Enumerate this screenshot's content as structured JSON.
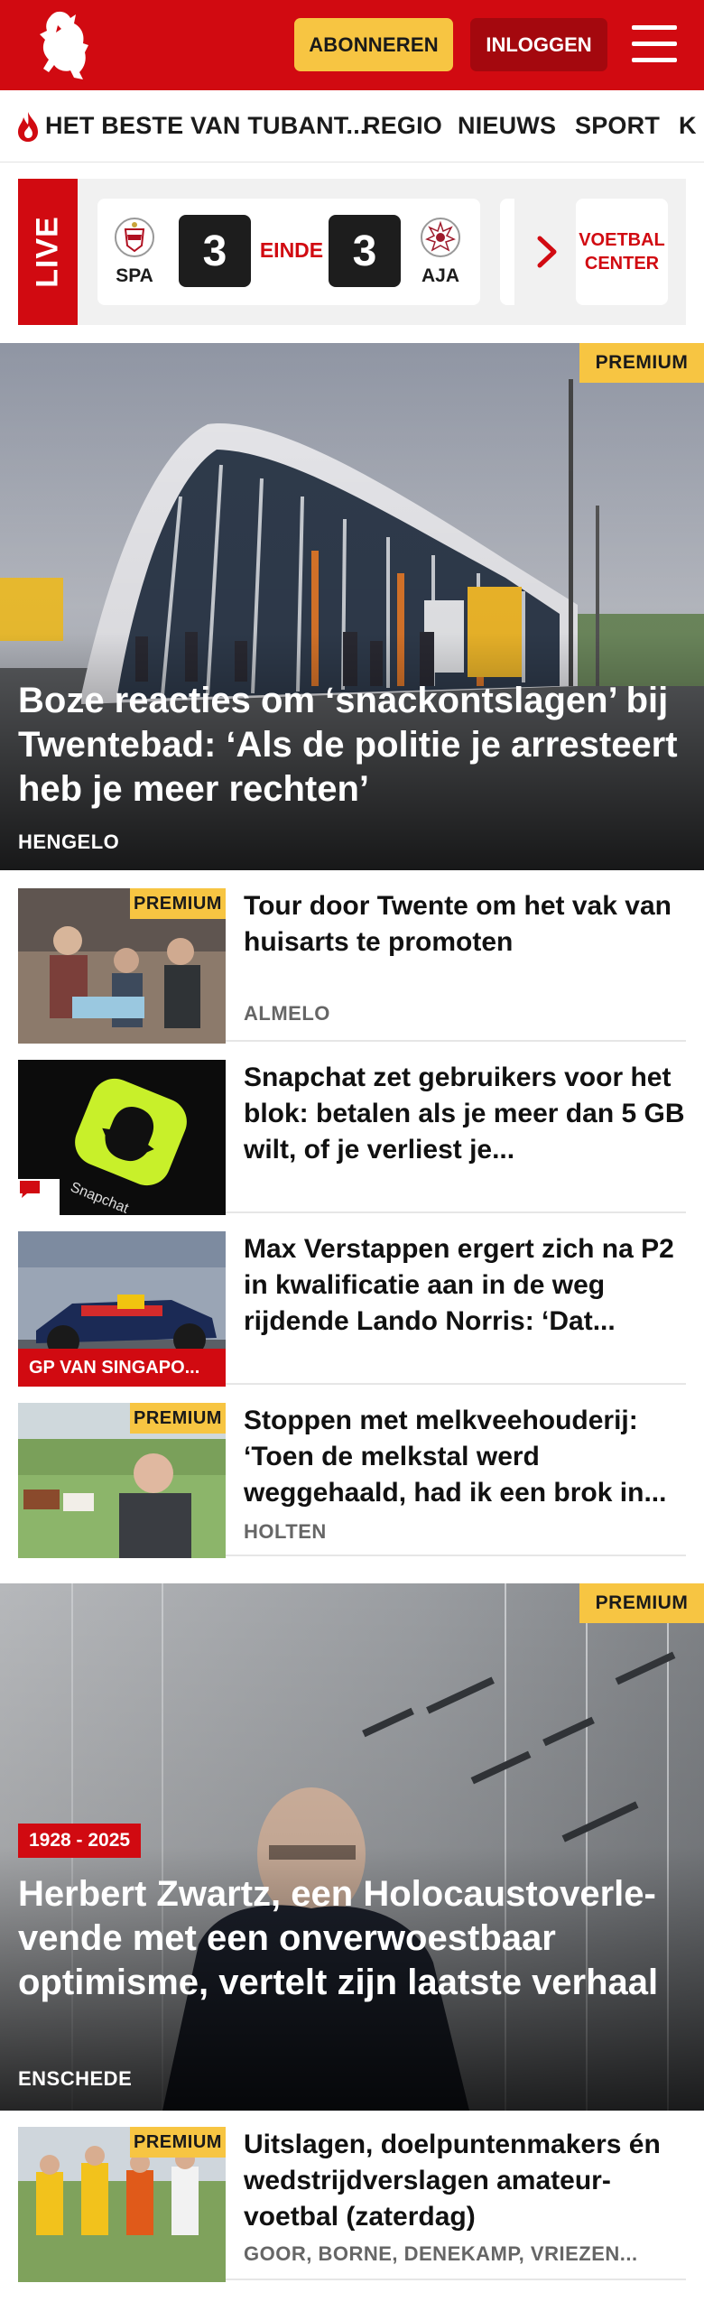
{
  "header": {
    "subscribe_label": "ABONNEREN",
    "login_label": "INLOGGEN",
    "brand_color": "#d10a11",
    "subscribe_color": "#f7c542",
    "icons": [
      "tubantia-horse-logo",
      "hamburger-menu-icon"
    ]
  },
  "nav": {
    "items": [
      "HET BESTE VAN TUBANT...",
      "REGIO",
      "NIEUWS",
      "SPORT",
      "K"
    ],
    "highlight_icon": "flame-icon"
  },
  "live": {
    "label": "LIVE",
    "match": {
      "home": "SPA",
      "away": "AJA",
      "home_score": "3",
      "away_score": "3",
      "status": "EINDE"
    },
    "voetbal_center": "VOETBAL CENTER"
  },
  "articles": {
    "hero1": {
      "badge": "PREMIUM",
      "title": "Boze reacties om ‘snackontslagen’ bij Twentebad: ‘Als de politie je arresteert heb je meer rechten’",
      "location": "HENGELO"
    },
    "list1": [
      {
        "badge": "PREMIUM",
        "title": "Tour door Twente om het vak van huisarts te promoten",
        "location": "ALMELO"
      },
      {
        "title": "Snapchat zet gebruikers voor het blok: betalen als je meer dan 5 GB wilt, of je verliest je...",
        "icon": "comment-icon"
      },
      {
        "title": "Max Verstappen ergert zich na P2 in kwalificatie aan in de weg rijdende Lando Norris: ‘Dat...",
        "topic": "GP VAN SINGAPO..."
      },
      {
        "badge": "PREMIUM",
        "title": "Stoppen met melkveehouderij: ‘Toen de melkstal werd weggehaald, had ik een brok in...",
        "location": "HOLTEN"
      }
    ],
    "hero2": {
      "badge": "PREMIUM",
      "year_badge": "1928 - 2025",
      "title": "Herbert Zwartz, een Holocaustoverle-vende met een onverwoestbaar optimisme, vertelt zijn laatste verhaal",
      "location": "ENSCHEDE"
    },
    "list2": [
      {
        "badge": "PREMIUM",
        "title": "Uitslagen, doelpuntenmakers én wedstrijdverslagen amateur-voetbal (zaterdag)",
        "location": "GOOR, BORNE, DENEKAMP, VRIEZEN..."
      }
    ]
  }
}
